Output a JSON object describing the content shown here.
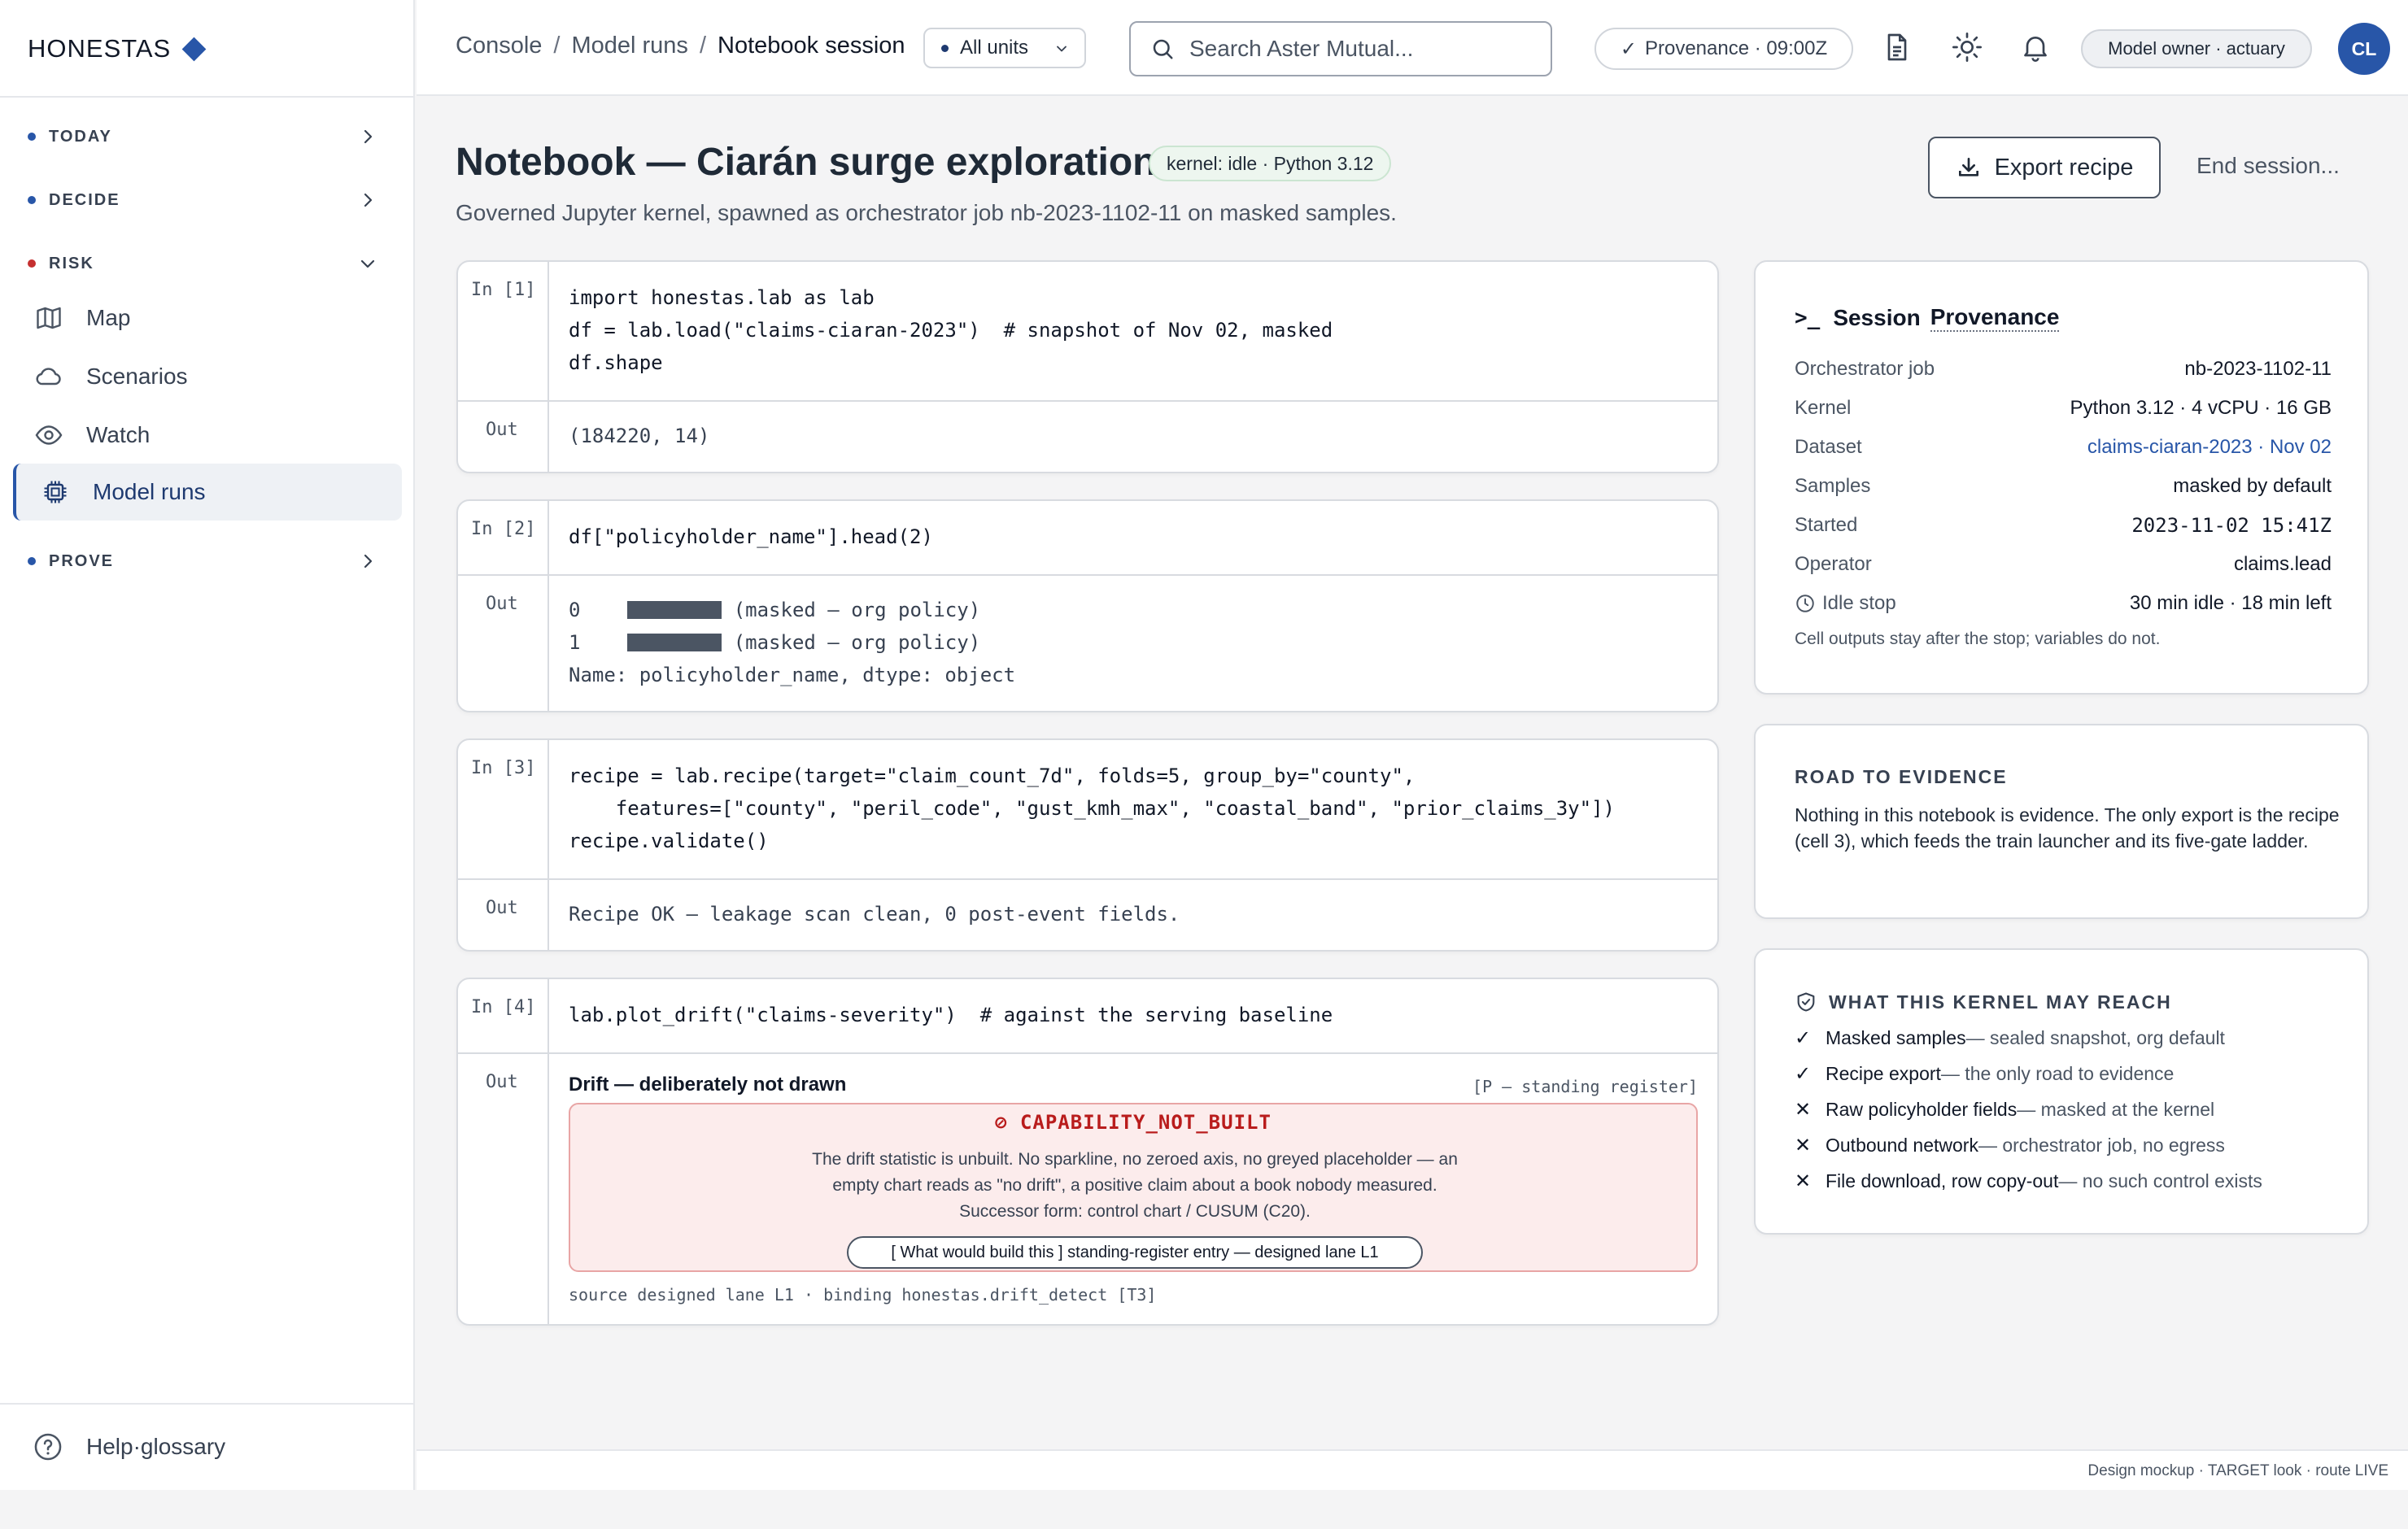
{
  "app": {
    "logo": "HONESTAS"
  },
  "sidebar": {
    "sections": [
      {
        "label": "TODAY"
      },
      {
        "label": "DECIDE"
      },
      {
        "label": "RISK"
      },
      {
        "label": "PROVE"
      }
    ],
    "risk_items": [
      {
        "label": "Map",
        "icon": "map-icon"
      },
      {
        "label": "Scenarios",
        "icon": "cloud-icon"
      },
      {
        "label": "Watch",
        "icon": "eye-icon"
      },
      {
        "label": "Model runs",
        "icon": "chip-icon",
        "active": true
      }
    ],
    "help": "Help·glossary"
  },
  "topbar": {
    "breadcrumb": [
      "Console",
      "Model runs",
      "Notebook session"
    ],
    "units": "All units",
    "search_placeholder": "Search Aster Mutual...",
    "provenance": "Provenance · 09:00Z",
    "role": "Model owner · actuary",
    "avatar": "CL"
  },
  "page": {
    "title": "Notebook — Ciarán surge exploration",
    "kernel_badge": "kernel: idle · Python 3.12",
    "subtitle": "Governed Jupyter kernel, spawned as orchestrator job nb-2023-1102-11 on masked samples.",
    "export_label": "Export recipe",
    "end_label": "End session..."
  },
  "cells": {
    "c1": {
      "in": "In [1]",
      "code": "import honestas.lab as lab\ndf = lab.load(\"claims-ciaran-2023\")  # snapshot of Nov 02, masked\ndf.shape",
      "out_prompt": "Out",
      "out": "(184220, 14)"
    },
    "c2": {
      "in": "In [2]",
      "code": "df[\"policyholder_name\"].head(2)",
      "out_prompt": "Out",
      "row0_idx": "0",
      "row1_idx": "1",
      "masked_note": "(masked — org policy)",
      "dtype_line": "Name: policyholder_name, dtype: object"
    },
    "c3": {
      "in": "In [3]",
      "code": "recipe = lab.recipe(target=\"claim_count_7d\", folds=5, group_by=\"county\",\n    features=[\"county\", \"peril_code\", \"gust_kmh_max\", \"coastal_band\", \"prior_claims_3y\"])\nrecipe.validate()",
      "out_prompt": "Out",
      "out": "Recipe OK — leakage scan clean, 0 post-event fields."
    },
    "c4": {
      "in": "In [4]",
      "code": "lab.plot_drift(\"claims-severity\")  # against the serving baseline",
      "out_prompt": "Out",
      "drift_title": "Drift — deliberately not drawn",
      "register": "[P — standing register]",
      "cap_title": "⊘ CAPABILITY_NOT_BUILT",
      "cap_line1": "The drift statistic is unbuilt. No sparkline, no zeroed axis, no greyed placeholder — an",
      "cap_line2": "empty chart reads as \"no drift\", a positive claim about a book nobody measured.",
      "cap_line3": "Successor form: control chart / CUSUM (C20).",
      "cap_button": "[ What would build this ] standing-register entry — designed lane L1",
      "source": "source designed lane L1 · binding honestas.drift_detect [T3]"
    }
  },
  "session": {
    "heading": "Session",
    "heading_link": "Provenance",
    "rows": [
      {
        "k": "Orchestrator job",
        "v": "nb-2023-1102-11"
      },
      {
        "k": "Kernel",
        "v": "Python 3.12 · 4 vCPU · 16 GB"
      },
      {
        "k": "Dataset",
        "v": "claims-ciaran-2023 · Nov 02"
      },
      {
        "k": "Samples",
        "v": "masked by default"
      },
      {
        "k": "Started",
        "v": "2023-11-02 15:41Z"
      },
      {
        "k": "Operator",
        "v": "claims.lead"
      },
      {
        "k": "Idle stop",
        "v": "30 min idle · 18 min left"
      }
    ],
    "note": "Cell outputs stay after the stop; variables do not."
  },
  "road": {
    "heading": "ROAD TO EVIDENCE",
    "body": "Nothing in this notebook is evidence. The only export is the recipe (cell 3), which feeds the train launcher and its five-gate ladder."
  },
  "reach": {
    "heading": "WHAT THIS KERNEL MAY REACH",
    "items": [
      {
        "mark": "✓",
        "lead": "Masked samples",
        "rest": " — sealed snapshot, org default"
      },
      {
        "mark": "✓",
        "lead": "Recipe export",
        "rest": " — the only road to evidence"
      },
      {
        "mark": "✕",
        "lead": "Raw policyholder fields",
        "rest": " — masked at the kernel"
      },
      {
        "mark": "✕",
        "lead": "Outbound network",
        "rest": " — orchestrator job, no egress"
      },
      {
        "mark": "✕",
        "lead": "File download, row copy-out",
        "rest": " — no such control exists"
      }
    ]
  },
  "footer": "Design mockup · TARGET look · route LIVE",
  "colors": {
    "accent": "#2856a8",
    "danger": "#b91c1c",
    "danger_bg": "#fcecec",
    "ok_bg": "#edf6ef"
  }
}
